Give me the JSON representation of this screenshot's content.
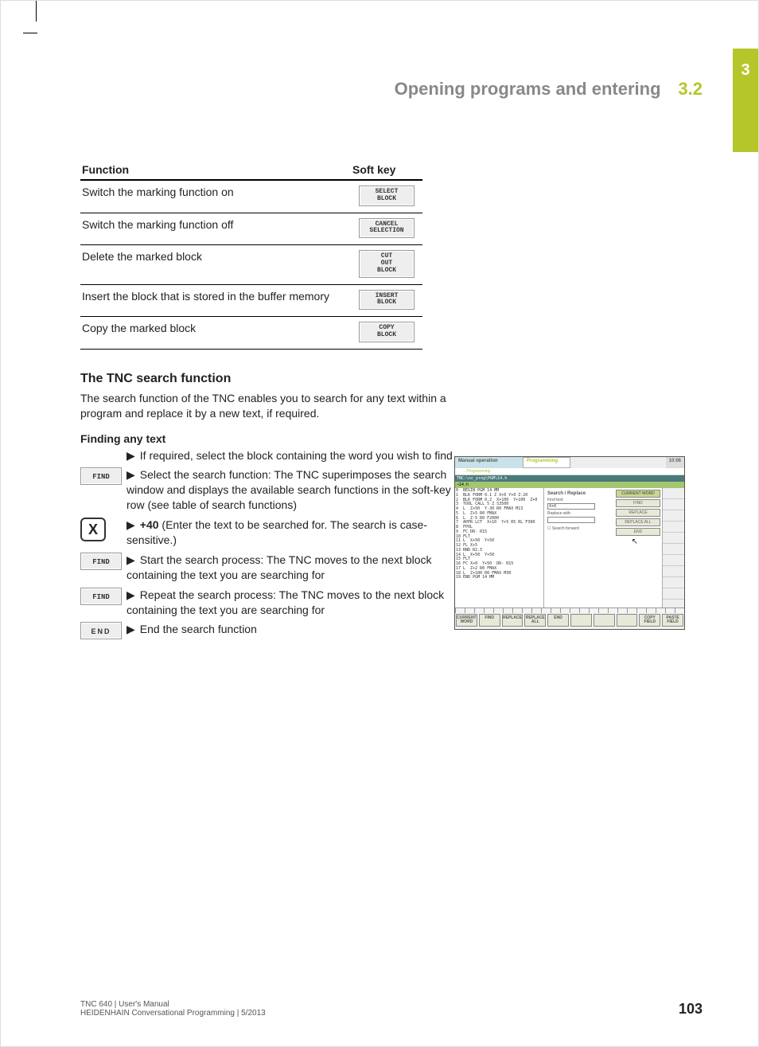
{
  "chapter_tab": "3",
  "header": {
    "title": "Opening programs and entering",
    "section": "3.2"
  },
  "table": {
    "headers": [
      "Function",
      "Soft key"
    ],
    "rows": [
      {
        "fn": "Switch the marking function on",
        "key": "SELECT\nBLOCK"
      },
      {
        "fn": "Switch the marking function off",
        "key": "CANCEL\nSELECTION"
      },
      {
        "fn": "Delete the marked block",
        "key": "CUT\nOUT\nBLOCK"
      },
      {
        "fn": "Insert the block that is stored in the buffer memory",
        "key": "INSERT\nBLOCK"
      },
      {
        "fn": "Copy the marked block",
        "key": "COPY\nBLOCK"
      }
    ]
  },
  "search": {
    "heading": "The TNC search function",
    "lead": "The search function of the TNC enables you to search for any text within a program and replace it by a new text, if required.",
    "sub": "Finding any text",
    "intro": "If required, select the block containing the word you wish to find",
    "steps": [
      {
        "icon": "FIND",
        "kind": "softkey",
        "text": "Select the search function: The TNC superimposes the search window and displays the available search functions in the soft-key row (see table of search functions)"
      },
      {
        "icon": "X",
        "kind": "key",
        "text_pre": "+40",
        "text_post": " (Enter the text to be searched for. The search is case-sensitive.)"
      },
      {
        "icon": "FIND",
        "kind": "softkey",
        "text": "Start the search process: The TNC moves to the next block containing the text you are searching for"
      },
      {
        "icon": "FIND",
        "kind": "softkey",
        "text": "Repeat the search process: The TNC moves to the next block containing the text you are searching for"
      },
      {
        "icon": "END",
        "kind": "key-wide",
        "text": "End the search function"
      }
    ]
  },
  "screenshot": {
    "mode_left": "Manual operation",
    "mode_right": "Programming",
    "sub": "→ Programming",
    "time": "10:06",
    "path": "TNC:\\nc_prog\\PGM\\14.h",
    "highlight": "→14.h",
    "code": "0  BEGIN PGM 14 MM\n1  BLK FORM 0.1 Z X+0 Y+0 Z-20\n2  BLK FORM 0.2  X+100  Y+100  Z+0\n3  TOOL CALL 5 Z S3500\n4  L  Z+50  Y-30 R0 FMAX M13\n5  L  Z+5 R0 FMAX\n6  L  Z-5 R0 F2000\n7  APPR LCT  X+10  Y+5 R5 RL F300\n8  FPOL\n9  FC DR- R15\n10 FLT\n11 L  X+50  Y+50\n12 FL X+5\n13 RND R2.5\n14 L  X+50  Y+50\n15 FLT\n16 FC X+0  Y+50  DR- R15\n17 L  Z+2 R0 FMAX\n18 L  Z+100 R0 FMAX M30\n19 END PGM 14 MM",
    "dialog": {
      "title": "Search / Replace",
      "find_label": "Find text:",
      "find_value": "X+0",
      "replace_label": "Replace with:",
      "forward": "Search forward",
      "buttons": [
        "CURRENT WORD",
        "FIND",
        "REPLACE",
        "REPLACE ALL",
        "END"
      ]
    },
    "softkeys": [
      "CURRENT\nWORD",
      "FIND",
      "REPLACE",
      "REPLACE\nALL",
      "END",
      "",
      "",
      "",
      "COPY\nFIELD",
      "PASTE\nFIELD"
    ]
  },
  "footer": {
    "line1": "TNC 640 | User's Manual",
    "line2": "HEIDENHAIN Conversational Programming | 5/2013",
    "page": "103"
  }
}
